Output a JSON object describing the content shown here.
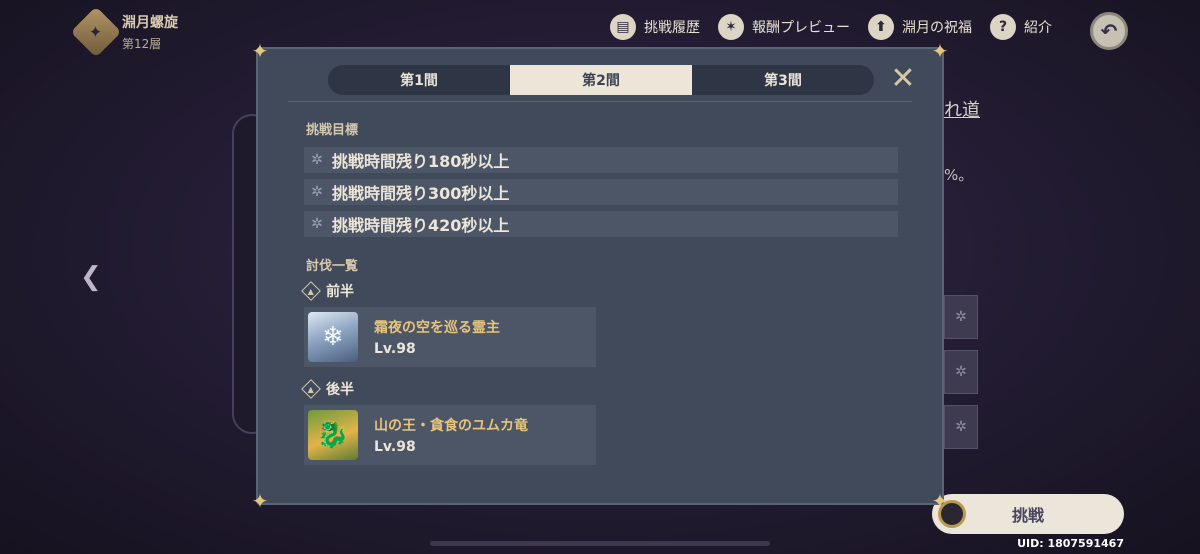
{
  "header": {
    "floor_title": "淵月螺旋",
    "floor_sub": "第12層",
    "nav": [
      {
        "label": "挑戦履歴",
        "icon": "book-icon"
      },
      {
        "label": "報酬プレビュー",
        "icon": "star-badge-icon"
      },
      {
        "label": "淵月の祝福",
        "icon": "upload-icon"
      },
      {
        "label": "紹介",
        "icon": "help-icon"
      }
    ],
    "back_glyph": "↶"
  },
  "background": {
    "right_text": "れ道",
    "right_pct": "%。",
    "left_arrow": "❮",
    "slot_glyph": "✲"
  },
  "modal": {
    "tabs": [
      "第1間",
      "第2間",
      "第3間"
    ],
    "active_tab": 1,
    "close_glyph": "✕",
    "objectives_title": "挑戦目標",
    "objectives": [
      "挑戦時間残り180秒以上",
      "挑戦時間残り300秒以上",
      "挑戦時間残り420秒以上"
    ],
    "enemies_title": "討伐一覧",
    "halves": [
      {
        "label": "前半",
        "enemy": {
          "name": "霜夜の空を巡る霊主",
          "level": "Lv.98",
          "icon": "ice-spirit-portrait-icon"
        }
      },
      {
        "label": "後半",
        "enemy": {
          "name": "山の王・貪食のユムカ竜",
          "level": "Lv.98",
          "icon": "dragon-portrait-icon"
        }
      }
    ]
  },
  "footer": {
    "challenge_label": "挑戦",
    "uid": "UID: 1807591467"
  },
  "colors": {
    "modal_bg": "#404a5b",
    "accent_gold": "#e8c47a",
    "tab_active": "#ece5d8"
  }
}
